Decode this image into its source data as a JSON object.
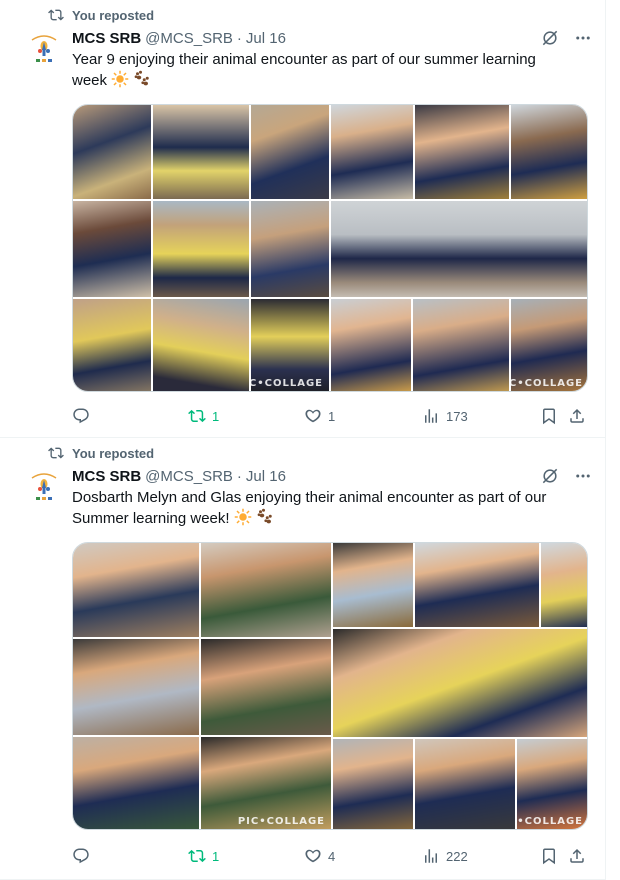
{
  "tweets": [
    {
      "repost_label": "You reposted",
      "name": "MCS SRB",
      "handle": "@MCS_SRB",
      "dot": "·",
      "date": "Jul 16",
      "text": "Year 9  enjoying their animal encounter as part of our summer learning week",
      "emojis": [
        "sun-emoji",
        "paw-prints-emoji"
      ],
      "watermarks": [
        "PIC•COLLAGE",
        "PIC•COLLAGE"
      ],
      "replies": "",
      "reposts": "1",
      "likes": "1",
      "views": "173"
    },
    {
      "repost_label": "You reposted",
      "name": "MCS SRB",
      "handle": "@MCS_SRB",
      "dot": "·",
      "date": "Jul 16",
      "text": "Dosbarth Melyn and Glas enjoying their animal encounter as part of our Summer learning week!",
      "emojis": [
        "sun-emoji",
        "paw-prints-emoji"
      ],
      "watermarks": [
        "PIC•COLLAGE",
        "PIC•COLLAGE"
      ],
      "replies": "",
      "reposts": "1",
      "likes": "4",
      "views": "222"
    }
  ],
  "colors": {
    "text": "#0f1419",
    "secondary": "#536471",
    "reposted": "#00ba7c",
    "divider": "#eff3f4"
  }
}
